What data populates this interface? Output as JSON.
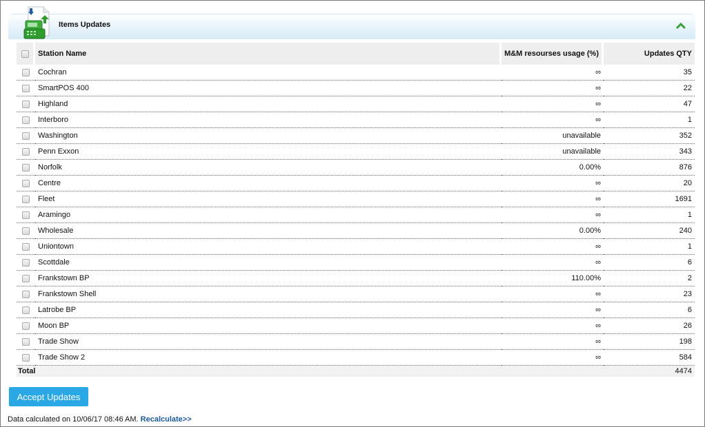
{
  "panel": {
    "title": "Items Updates",
    "icon": "pos-terminal-update-icon",
    "collapse_icon": "chevron-up-icon",
    "accent_color": "#2aa8e6",
    "collapse_color": "#3aa13a"
  },
  "table": {
    "columns": {
      "station": "Station Name",
      "usage": "M&M resourses usage (%)",
      "qty": "Updates QTY"
    },
    "rows": [
      {
        "station": "Cochran",
        "usage": "∞",
        "qty": "35"
      },
      {
        "station": "SmartPOS 400",
        "usage": "∞",
        "qty": "22"
      },
      {
        "station": "Highland",
        "usage": "∞",
        "qty": "47"
      },
      {
        "station": "Interboro",
        "usage": "∞",
        "qty": "1"
      },
      {
        "station": "Washington",
        "usage": "unavailable",
        "qty": "352"
      },
      {
        "station": "Penn Exxon",
        "usage": "unavailable",
        "qty": "343"
      },
      {
        "station": "Norfolk",
        "usage": "0.00%",
        "qty": "876"
      },
      {
        "station": "Centre",
        "usage": "∞",
        "qty": "20"
      },
      {
        "station": "Fleet",
        "usage": "∞",
        "qty": "1691"
      },
      {
        "station": "Aramingo",
        "usage": "∞",
        "qty": "1"
      },
      {
        "station": "Wholesale",
        "usage": "0.00%",
        "qty": "240"
      },
      {
        "station": "Uniontown",
        "usage": "∞",
        "qty": "1"
      },
      {
        "station": "Scottdale",
        "usage": "∞",
        "qty": "6"
      },
      {
        "station": "Frankstown BP",
        "usage": "110.00%",
        "qty": "2"
      },
      {
        "station": "Frankstown Shell",
        "usage": "∞",
        "qty": "23"
      },
      {
        "station": "Latrobe BP",
        "usage": "∞",
        "qty": "6"
      },
      {
        "station": "Moon BP",
        "usage": "∞",
        "qty": "26"
      },
      {
        "station": "Trade Show",
        "usage": "∞",
        "qty": "198"
      },
      {
        "station": "Trade Show 2",
        "usage": "∞",
        "qty": "584"
      }
    ],
    "total": {
      "label": "Total",
      "qty": "4474"
    }
  },
  "actions": {
    "accept_label": "Accept Updates"
  },
  "footer": {
    "prefix": "Data calculated on 10/06/17 08:46 AM.",
    "recalc_label": "Recalculate>>"
  }
}
